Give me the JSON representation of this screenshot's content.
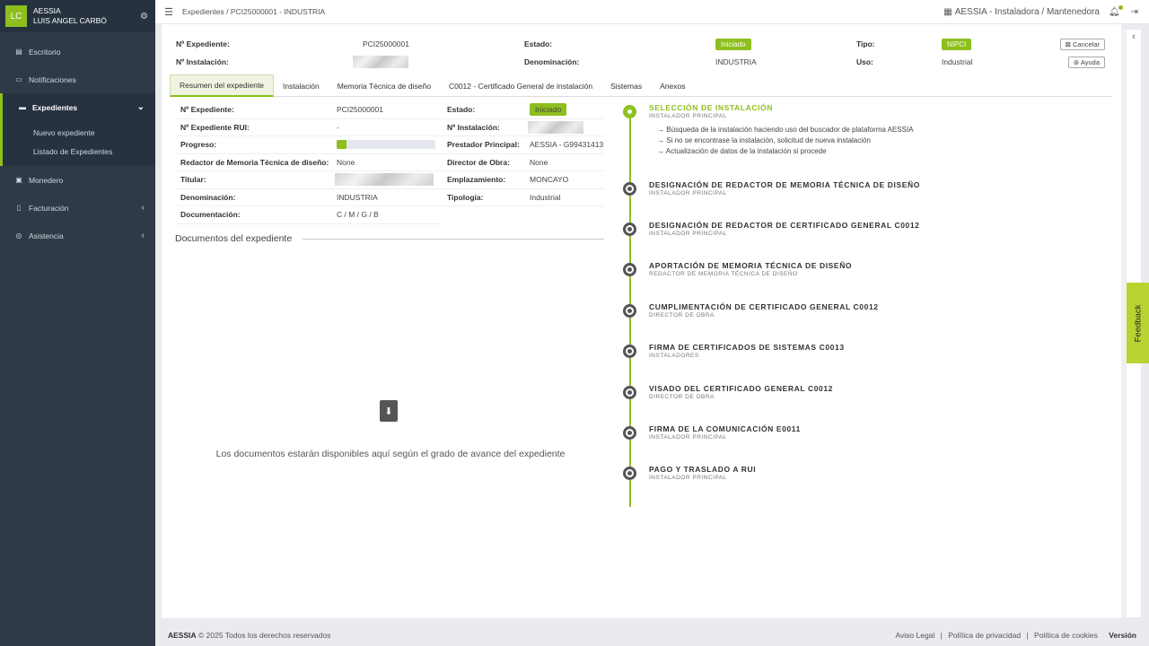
{
  "user": {
    "initials": "LC",
    "org": "AESSIA",
    "name": "LUIS ANGEL CARBÓ"
  },
  "sidebar": {
    "items": [
      {
        "label": "Escritorio",
        "icon": "chart-icon"
      },
      {
        "label": "Notificaciones",
        "icon": "inbox-icon"
      },
      {
        "label": "Expedientes",
        "icon": "folder-icon"
      },
      {
        "label": "Monedero",
        "icon": "wallet-icon"
      },
      {
        "label": "Facturación",
        "icon": "invoice-icon"
      },
      {
        "label": "Asistencia",
        "icon": "lifebuoy-icon"
      }
    ],
    "subitems": [
      "Nuevo expediente",
      "Listado de Expedientes"
    ]
  },
  "topbar": {
    "breadcrumb": "Expedientes / PCI25000001 - INDUSTRIA",
    "company": "AESSIA - Instaladora / Mantenedora"
  },
  "header": {
    "expediente_label": "Nº Expediente:",
    "expediente": "PCI25000001",
    "estado_label": "Estado:",
    "estado": "Iniciado",
    "tipo_label": "Tipo:",
    "tipo": "NIPCI",
    "instalacion_label": "Nº Instalación:",
    "denominacion_label": "Denominación:",
    "denominacion": "INDUSTRIA",
    "uso_label": "Uso:",
    "uso": "Industrial",
    "cancel_label": "Cancelar",
    "help_label": "Ayuda"
  },
  "tabs": [
    "Resumen del expediente",
    "Instalación",
    "Memoria Técnica de diseño",
    "C0012 - Certificado General de instalación",
    "Sistemas",
    "Anexos"
  ],
  "summary": {
    "expediente_label": "Nº Expediente:",
    "expediente": "PCI25000001",
    "estado_label": "Estado:",
    "estado": "Iniciado",
    "rui_label": "Nº Expediente RUI:",
    "rui": "-",
    "instalacion_label": "Nº Instalación:",
    "progreso_label": "Progreso:",
    "progreso": 0.1,
    "prestador_label": "Prestador Principal:",
    "prestador": "AESSIA - G99431413",
    "redactor_label": "Redactor de Memoria Técnica de diseño:",
    "redactor": "None",
    "director_label": "Director de Obra:",
    "director": "None",
    "titular_label": "Titular:",
    "emplazamiento_label": "Emplazamiento:",
    "emplazamiento": "MONCAYO",
    "denominacion_label": "Denominación:",
    "denominacion": "INDUSTRIA",
    "tipologia_label": "Tipología:",
    "tipologia": "Industrial",
    "documentacion_label": "Documentación:",
    "documentacion": "C / M / G / B"
  },
  "documents": {
    "title": "Documentos del expediente",
    "message": "Los documentos estarán disponibles aquí según el grado de avance del expediente"
  },
  "timeline": [
    {
      "title": "SELECCIÓN DE INSTALACIÓN",
      "sub": "INSTALADOR PRINCIPAL",
      "current": true,
      "tasks": [
        "Búsqueda de la instalación haciendo uso del buscador de plataforma AESSIA",
        "Si no se encontrase la instalación, solicitud de nueva instalación",
        "Actualización de datos de la instalación si procede"
      ]
    },
    {
      "title": "DESIGNACIÓN DE REDACTOR DE MEMORIA TÉCNICA DE DISEÑO",
      "sub": "INSTALADOR PRINCIPAL"
    },
    {
      "title": "DESIGNACIÓN DE REDACTOR DE CERTIFICADO GENERAL C0012",
      "sub": "INSTALADOR PRINCIPAL"
    },
    {
      "title": "APORTACIÓN DE MEMORIA TÉCNICA DE DISEÑO",
      "sub": "REDACTOR DE MEMORIA TÉCNICA DE DISEÑO"
    },
    {
      "title": "CUMPLIMENTACIÓN DE CERTIFICADO GENERAL C0012",
      "sub": "DIRECTOR DE OBRA"
    },
    {
      "title": "FIRMA DE CERTIFICADOS DE SISTEMAS C0013",
      "sub": "INSTALADORES"
    },
    {
      "title": "VISADO DEL CERTIFICADO GENERAL C0012",
      "sub": "DIRECTOR DE OBRA"
    },
    {
      "title": "FIRMA DE LA COMUNICACIÓN E0011",
      "sub": "INSTALADOR PRINCIPAL"
    },
    {
      "title": "PAGO Y TRASLADO A RUI",
      "sub": "INSTALADOR PRINCIPAL"
    }
  ],
  "feedback_label": "Feedback",
  "footer": {
    "brand": "AESSIA",
    "copyright": "© 2025 Todos los derechos reservados",
    "links": [
      "Aviso Legal",
      "|",
      "Política de privacidad",
      "|",
      "Política de cookies"
    ],
    "version": "Versión"
  },
  "colors": {
    "accent": "#8dbf1e",
    "sidebar": "#2f3a48"
  }
}
